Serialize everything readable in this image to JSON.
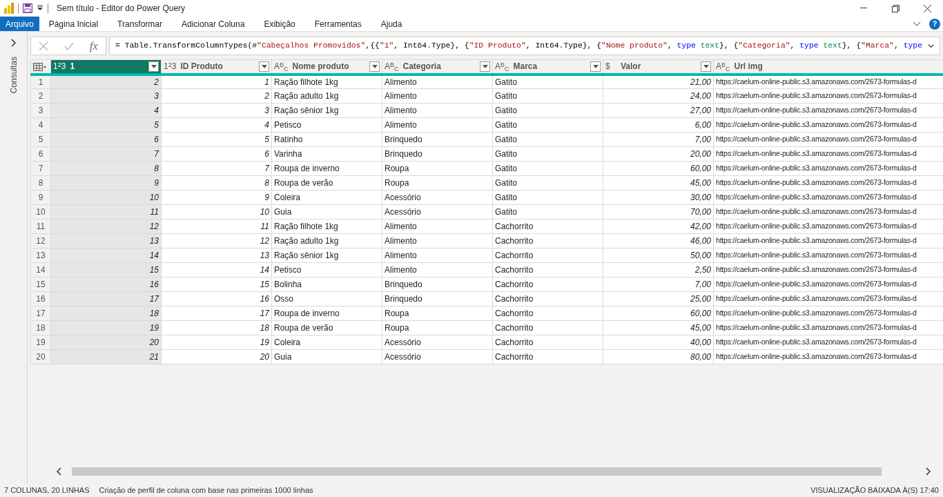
{
  "window": {
    "title": "Sem título - Editor do Power Query"
  },
  "ribbon_tabs": [
    {
      "label": "Arquivo",
      "selected": true
    },
    {
      "label": "Página Inicial",
      "selected": false
    },
    {
      "label": "Transformar",
      "selected": false
    },
    {
      "label": "Adicionar Coluna",
      "selected": false
    },
    {
      "label": "Exibição",
      "selected": false
    },
    {
      "label": "Ferramentas",
      "selected": false
    },
    {
      "label": "Ajuda",
      "selected": false
    }
  ],
  "help_label": "?",
  "queries_pane": {
    "label": "Consultas",
    "expanded": false
  },
  "formula_bar": {
    "fx_label": "fx",
    "segments": [
      {
        "kind": "plain",
        "text": "= Table.TransformColumnTypes(#"
      },
      {
        "kind": "string",
        "text": "\"Cabeçalhos Promovidos\""
      },
      {
        "kind": "plain",
        "text": ",{{"
      },
      {
        "kind": "string",
        "text": "\"1\""
      },
      {
        "kind": "plain",
        "text": ", Int64.Type}, {"
      },
      {
        "kind": "string",
        "text": "\"ID Produto\""
      },
      {
        "kind": "plain",
        "text": ", Int64.Type}, {"
      },
      {
        "kind": "string",
        "text": "\"Nome produto\""
      },
      {
        "kind": "plain",
        "text": ", "
      },
      {
        "kind": "keyword",
        "text": "type"
      },
      {
        "kind": "typename",
        "text": " text"
      },
      {
        "kind": "plain",
        "text": "}, {"
      },
      {
        "kind": "string",
        "text": "\"Categoria\""
      },
      {
        "kind": "plain",
        "text": ", "
      },
      {
        "kind": "keyword",
        "text": "type"
      },
      {
        "kind": "typename",
        "text": " text"
      },
      {
        "kind": "plain",
        "text": "}, {"
      },
      {
        "kind": "string",
        "text": "\"Marca\""
      },
      {
        "kind": "plain",
        "text": ", "
      },
      {
        "kind": "keyword",
        "text": "type"
      }
    ]
  },
  "table": {
    "columns": [
      {
        "kind": "index"
      },
      {
        "name": "1",
        "type_label": "1$^{2}$3",
        "kind": "number",
        "selected": true
      },
      {
        "name": "ID Produto",
        "type_label": "1$^{2}$3",
        "kind": "number",
        "selected": false
      },
      {
        "name": "Nome produto",
        "type_label": "A$^{B}$$_{C}$",
        "kind": "text",
        "selected": false
      },
      {
        "name": "Categoria",
        "type_label": "A$^{B}$$_{C}$",
        "kind": "text",
        "selected": false
      },
      {
        "name": "Marca",
        "type_label": "A$^{B}$$_{C}$",
        "kind": "text",
        "selected": false
      },
      {
        "name": "Valor",
        "type_label": "$",
        "kind": "number",
        "selected": false
      },
      {
        "name": "Url img",
        "type_label": "A$^{B}$$_{C}$",
        "kind": "text",
        "selected": false
      }
    ],
    "rows": [
      [
        "1",
        "2",
        "1",
        "Ração filhote 1kg",
        "Alimento",
        "Gatito",
        "21,00",
        "https://caelum-online-public.s3.amazonaws.com/2673-formulas-d"
      ],
      [
        "2",
        "3",
        "2",
        "Ração adulto 1kg",
        "Alimento",
        "Gatito",
        "24,00",
        "https://caelum-online-public.s3.amazonaws.com/2673-formulas-d"
      ],
      [
        "3",
        "4",
        "3",
        "Ração sênior 1kg",
        "Alimento",
        "Gatito",
        "27,00",
        "https://caelum-online-public.s3.amazonaws.com/2673-formulas-d"
      ],
      [
        "4",
        "5",
        "4",
        "Petisco",
        "Alimento",
        "Gatito",
        "6,00",
        "https://caelum-online-public.s3.amazonaws.com/2673-formulas-d"
      ],
      [
        "5",
        "6",
        "5",
        "Ratinho",
        "Brinquedo",
        "Gatito",
        "7,00",
        "https://caelum-online-public.s3.amazonaws.com/2673-formulas-d"
      ],
      [
        "6",
        "7",
        "6",
        "Varinha",
        "Brinquedo",
        "Gatito",
        "20,00",
        "https://caelum-online-public.s3.amazonaws.com/2673-formulas-d"
      ],
      [
        "7",
        "8",
        "7",
        "Roupa de inverno",
        "Roupa",
        "Gatito",
        "60,00",
        "https://caelum-online-public.s3.amazonaws.com/2673-formulas-d"
      ],
      [
        "8",
        "9",
        "8",
        "Roupa de verão",
        "Roupa",
        "Gatito",
        "45,00",
        "https://caelum-online-public.s3.amazonaws.com/2673-formulas-d"
      ],
      [
        "9",
        "10",
        "9",
        "Coleira",
        "Acessório",
        "Gatito",
        "30,00",
        "https://caelum-online-public.s3.amazonaws.com/2673-formulas-d"
      ],
      [
        "10",
        "11",
        "10",
        "Guia",
        "Acessório",
        "Gatito",
        "70,00",
        "https://caelum-online-public.s3.amazonaws.com/2673-formulas-d"
      ],
      [
        "11",
        "12",
        "11",
        "Ração filhote 1kg",
        "Alimento",
        "Cachorrito",
        "42,00",
        "https://caelum-online-public.s3.amazonaws.com/2673-formulas-d"
      ],
      [
        "12",
        "13",
        "12",
        "Ração adulto 1kg",
        "Alimento",
        "Cachorrito",
        "46,00",
        "https://caelum-online-public.s3.amazonaws.com/2673-formulas-d"
      ],
      [
        "13",
        "14",
        "13",
        "Ração sênior 1kg",
        "Alimento",
        "Cachorrito",
        "50,00",
        "https://caelum-online-public.s3.amazonaws.com/2673-formulas-d"
      ],
      [
        "14",
        "15",
        "14",
        "Petisco",
        "Alimento",
        "Cachorrito",
        "2,50",
        "https://caelum-online-public.s3.amazonaws.com/2673-formulas-d"
      ],
      [
        "15",
        "16",
        "15",
        "Bolinha",
        "Brinquedo",
        "Cachorrito",
        "7,00",
        "https://caelum-online-public.s3.amazonaws.com/2673-formulas-d"
      ],
      [
        "16",
        "17",
        "16",
        "Osso",
        "Brinquedo",
        "Cachorrito",
        "25,00",
        "https://caelum-online-public.s3.amazonaws.com/2673-formulas-d"
      ],
      [
        "17",
        "18",
        "17",
        "Roupa de inverno",
        "Roupa",
        "Cachorrito",
        "60,00",
        "https://caelum-online-public.s3.amazonaws.com/2673-formulas-d"
      ],
      [
        "18",
        "19",
        "18",
        "Roupa de verão",
        "Roupa",
        "Cachorrito",
        "45,00",
        "https://caelum-online-public.s3.amazonaws.com/2673-formulas-d"
      ],
      [
        "19",
        "20",
        "19",
        "Coleira",
        "Acessório",
        "Cachorrito",
        "40,00",
        "https://caelum-online-public.s3.amazonaws.com/2673-formulas-d"
      ],
      [
        "20",
        "21",
        "20",
        "Guia",
        "Acessório",
        "Cachorrito",
        "80,00",
        "https://caelum-online-public.s3.amazonaws.com/2673-formulas-d"
      ]
    ]
  },
  "status_bar": {
    "left": [
      "7 COLUNAS, 20 LINHAS",
      "Criação de perfil de coluna com base nas primeiras 1000 linhas"
    ],
    "right": "VISUALIZAÇÃO BAIXADA À(S) 17:40"
  }
}
